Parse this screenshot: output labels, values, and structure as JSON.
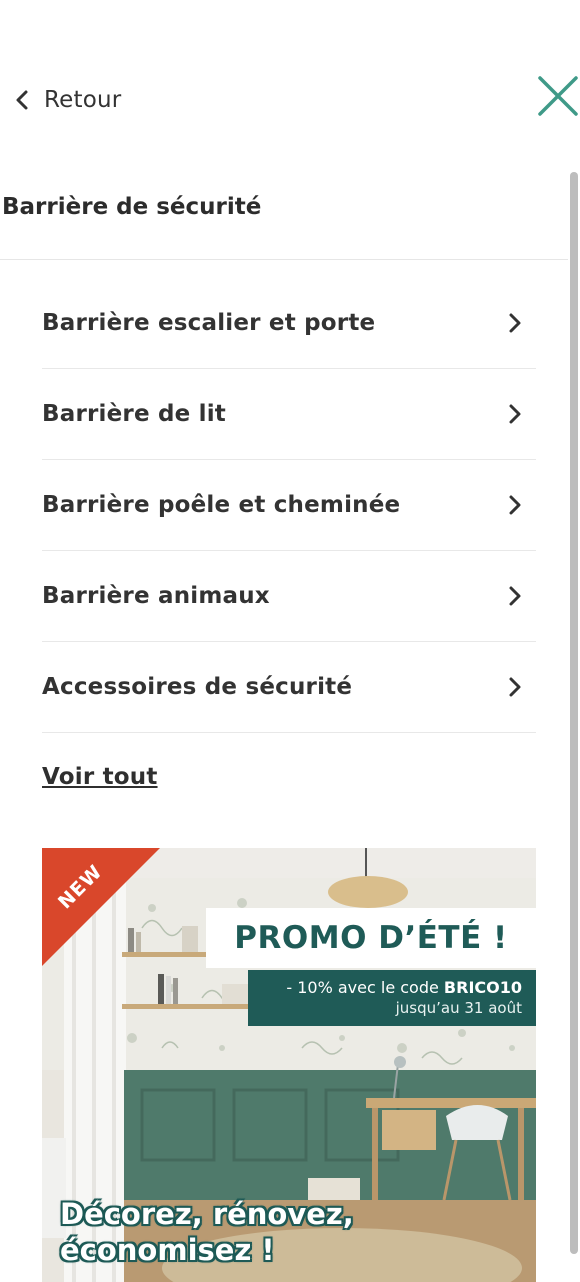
{
  "header": {
    "back_label": "Retour",
    "close_icon": "close-icon",
    "accent_color": "#3f9a88"
  },
  "section": {
    "title": "Barrière de sécurité"
  },
  "menu": {
    "items": [
      {
        "label": "Barrière escalier et porte"
      },
      {
        "label": "Barrière de lit"
      },
      {
        "label": "Barrière poêle et cheminée"
      },
      {
        "label": "Barrière animaux"
      },
      {
        "label": "Accessoires de sécurité"
      }
    ],
    "see_all": "Voir tout"
  },
  "banner": {
    "badge": "NEW",
    "title": "PROMO D’ÉTÉ !",
    "offer_prefix": "- 10% avec le code ",
    "offer_code": "BRICO10",
    "offer_until": "jusqu’au 31 août",
    "slogan_line1": "Décorez, rénovez,",
    "slogan_line2": "économisez !",
    "brand_color": "#1f5b57",
    "badge_color": "#d9472b"
  }
}
